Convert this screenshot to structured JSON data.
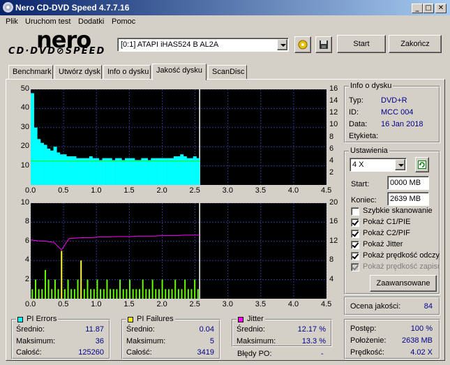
{
  "window": {
    "title": "Nero CD-DVD Speed 4.7.7.16",
    "minimize": "_",
    "maximize": "□",
    "close": "✕"
  },
  "menu": [
    "Plik",
    "Uruchom test",
    "Dodatki",
    "Pomoc"
  ],
  "logo": {
    "brand": "nero",
    "sub": "CD·DVD⊘SPEED"
  },
  "drive": {
    "selected": "[0:1]   ATAPI iHAS524   B AL2A"
  },
  "toolbar": {
    "start": "Start",
    "close_app": "Zakończ"
  },
  "tabs": [
    "Benchmark",
    "Utwórz dysk",
    "Info o dysku",
    "Jakość dysku",
    "ScanDisc"
  ],
  "disc_info": {
    "title": "Info o dysku",
    "rows": [
      {
        "label": "Typ:",
        "value": "DVD+R"
      },
      {
        "label": "ID:",
        "value": "MCC 004"
      },
      {
        "label": "Data:",
        "value": "16 Jan 2018"
      },
      {
        "label": "Etykieta:",
        "value": ""
      }
    ]
  },
  "settings": {
    "title": "Ustawienia",
    "speed": "4 X",
    "start_label": "Start:",
    "start_value": "0000 MB",
    "end_label": "Koniec:",
    "end_value": "2639 MB",
    "checkboxes": [
      {
        "label": "Szybkie skanowanie",
        "checked": false,
        "disabled": false
      },
      {
        "label": "Pokaż C1/PIE",
        "checked": true,
        "disabled": false
      },
      {
        "label": "Pokaż C2/PIF",
        "checked": true,
        "disabled": false
      },
      {
        "label": "Pokaż Jitter",
        "checked": true,
        "disabled": false
      },
      {
        "label": "Pokaż prędkość odczytu",
        "checked": true,
        "disabled": false
      },
      {
        "label": "Pokaż prędkość zapisu",
        "checked": true,
        "disabled": true
      }
    ],
    "advanced": "Zaawansowane"
  },
  "quality": {
    "label": "Ocena jakości:",
    "value": "84"
  },
  "progress": {
    "rows": [
      {
        "label": "Postęp:",
        "value": "100 %"
      },
      {
        "label": "Położenie:",
        "value": "2638 MB"
      },
      {
        "label": "Prędkość:",
        "value": "4.02 X"
      }
    ]
  },
  "pi_errors": {
    "title": "PI Errors",
    "color": "#00ffff",
    "rows": [
      {
        "label": "Średnio:",
        "value": "11.87"
      },
      {
        "label": "Maksimum:",
        "value": "36"
      },
      {
        "label": "Całość:",
        "value": "125260"
      }
    ]
  },
  "pi_failures": {
    "title": "PI Failures",
    "color": "#ffff00",
    "rows": [
      {
        "label": "Średnio:",
        "value": "0.04"
      },
      {
        "label": "Maksimum:",
        "value": "5"
      },
      {
        "label": "Całość:",
        "value": "3419"
      }
    ]
  },
  "jitter": {
    "title": "Jitter",
    "color": "#ff00ff",
    "rows": [
      {
        "label": "Średnio:",
        "value": "12.17 %"
      },
      {
        "label": "Maksimum:",
        "value": "13.3 %"
      }
    ],
    "po_label": "Błędy PO:",
    "po_value": "-"
  },
  "chart_data": [
    {
      "type": "area",
      "x_ticks": [
        "0.0",
        "0.5",
        "1.0",
        "1.5",
        "2.0",
        "2.5",
        "3.0",
        "3.5",
        "4.0",
        "4.5"
      ],
      "y_left_ticks": [
        "50",
        "40",
        "30",
        "20",
        "10"
      ],
      "y_right_ticks": [
        "16",
        "14",
        "12",
        "10",
        "8",
        "6",
        "4",
        "2"
      ],
      "xlim": [
        0,
        4.5
      ],
      "ylim": [
        0,
        50
      ],
      "y2lim": [
        0,
        16
      ],
      "cursor_x": 2.57,
      "series": [
        {
          "name": "PI Errors",
          "color": "#00ffff",
          "values": [
            48,
            30,
            24,
            22,
            21,
            19,
            18,
            20,
            17,
            16,
            16,
            15,
            15,
            15,
            14,
            14,
            14,
            14,
            15,
            14,
            14,
            13,
            14,
            14,
            14,
            13,
            14,
            14,
            13,
            14,
            14,
            14,
            13,
            13,
            14,
            14,
            13,
            14,
            14,
            14,
            14,
            14,
            14,
            14,
            15,
            15,
            16,
            15,
            14,
            14,
            15,
            14
          ]
        },
        {
          "name": "read-speed",
          "color": "#00ff00",
          "values": [
            4.0,
            4.0,
            4.0,
            4.0,
            4.0,
            4.0,
            4.0,
            4.0,
            4.0,
            4.0,
            4.0,
            4.0
          ]
        }
      ]
    },
    {
      "type": "bar",
      "x_ticks": [
        "0.0",
        "0.5",
        "1.0",
        "1.5",
        "2.0",
        "2.5",
        "3.0",
        "3.5",
        "4.0",
        "4.5"
      ],
      "y_left_ticks": [
        "10",
        "8",
        "6",
        "4",
        "2"
      ],
      "y_right_ticks": [
        "20",
        "16",
        "12",
        "8",
        "4"
      ],
      "xlim": [
        0,
        4.5
      ],
      "ylim": [
        0,
        10
      ],
      "y2lim": [
        0,
        20
      ],
      "cursor_x": 2.57,
      "series": [
        {
          "name": "PI Failures",
          "color": "#66ff00",
          "values": [
            1,
            2,
            1,
            1,
            3,
            2,
            1,
            2,
            1,
            5,
            1,
            2,
            1,
            1,
            2,
            4,
            1,
            2,
            1,
            1,
            2,
            1,
            1,
            2,
            1,
            1,
            1,
            2,
            1,
            1,
            2,
            1,
            1,
            1,
            2,
            1,
            1,
            2,
            1,
            1,
            2,
            1,
            1,
            1,
            2,
            1,
            1,
            2,
            1,
            1,
            2,
            1
          ]
        },
        {
          "name": "Jitter",
          "color": "#ff00ff",
          "values": [
            12.3,
            12.1,
            12.0,
            11.8,
            10.2,
            12.6,
            12.7,
            12.8,
            12.8,
            12.9,
            12.9,
            13.0,
            13.0,
            13.0,
            13.1,
            13.1,
            13.1,
            13.2,
            13.2,
            13.2,
            13.3,
            13.3,
            13.3
          ]
        }
      ]
    }
  ]
}
